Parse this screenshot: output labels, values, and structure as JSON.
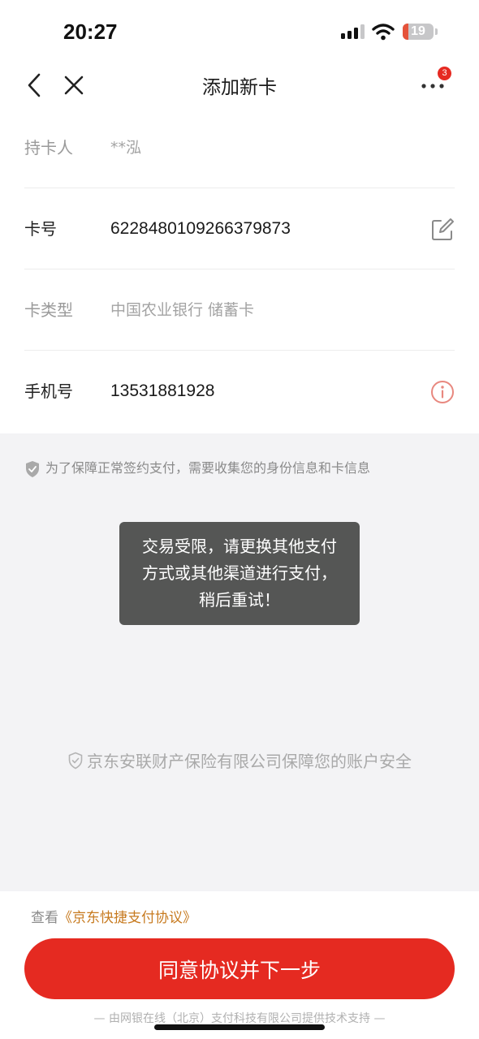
{
  "status_bar": {
    "time": "20:27",
    "battery_level": "19",
    "battery_fraction": 0.19,
    "icons": [
      "signal-icon",
      "wifi-icon",
      "battery-icon"
    ]
  },
  "nav": {
    "title": "添加新卡",
    "badge_count": "3",
    "icons": [
      "back-arrow-icon",
      "close-icon",
      "more-icon"
    ]
  },
  "form": {
    "rows": [
      {
        "label": "持卡人",
        "value": "**泓"
      },
      {
        "label": "卡号",
        "value": "6228480109266379873",
        "icon": "edit-icon"
      },
      {
        "label": "卡类型",
        "value": "中国农业银行 储蓄卡"
      },
      {
        "label": "手机号",
        "value": "13531881928",
        "icon": "info-icon"
      }
    ]
  },
  "notice": {
    "text": "为了保障正常签约支付，需要收集您的身份信息和卡信息",
    "icon": "shield-icon"
  },
  "toast": {
    "lines": [
      "交易受限，请更换其他支付",
      "方式或其他渠道进行支付，",
      "稍后重试！"
    ]
  },
  "insurance": {
    "text": "京东安联财产保险有限公司保障您的账户安全",
    "icon": "shield-check-icon"
  },
  "footer": {
    "agreement_prefix": "查看",
    "agreement_link": "《京东快捷支付协议》",
    "button_label": "同意协议并下一步",
    "provider_text": "— 由网银在线（北京）支付科技有限公司提供技术支持 —"
  },
  "colors": {
    "brand_red": "#e52a21",
    "link_orange": "#c77a1f",
    "toast_bg": "#555655",
    "page_bg": "#f3f3f5",
    "info_icon": "#e8887f"
  }
}
